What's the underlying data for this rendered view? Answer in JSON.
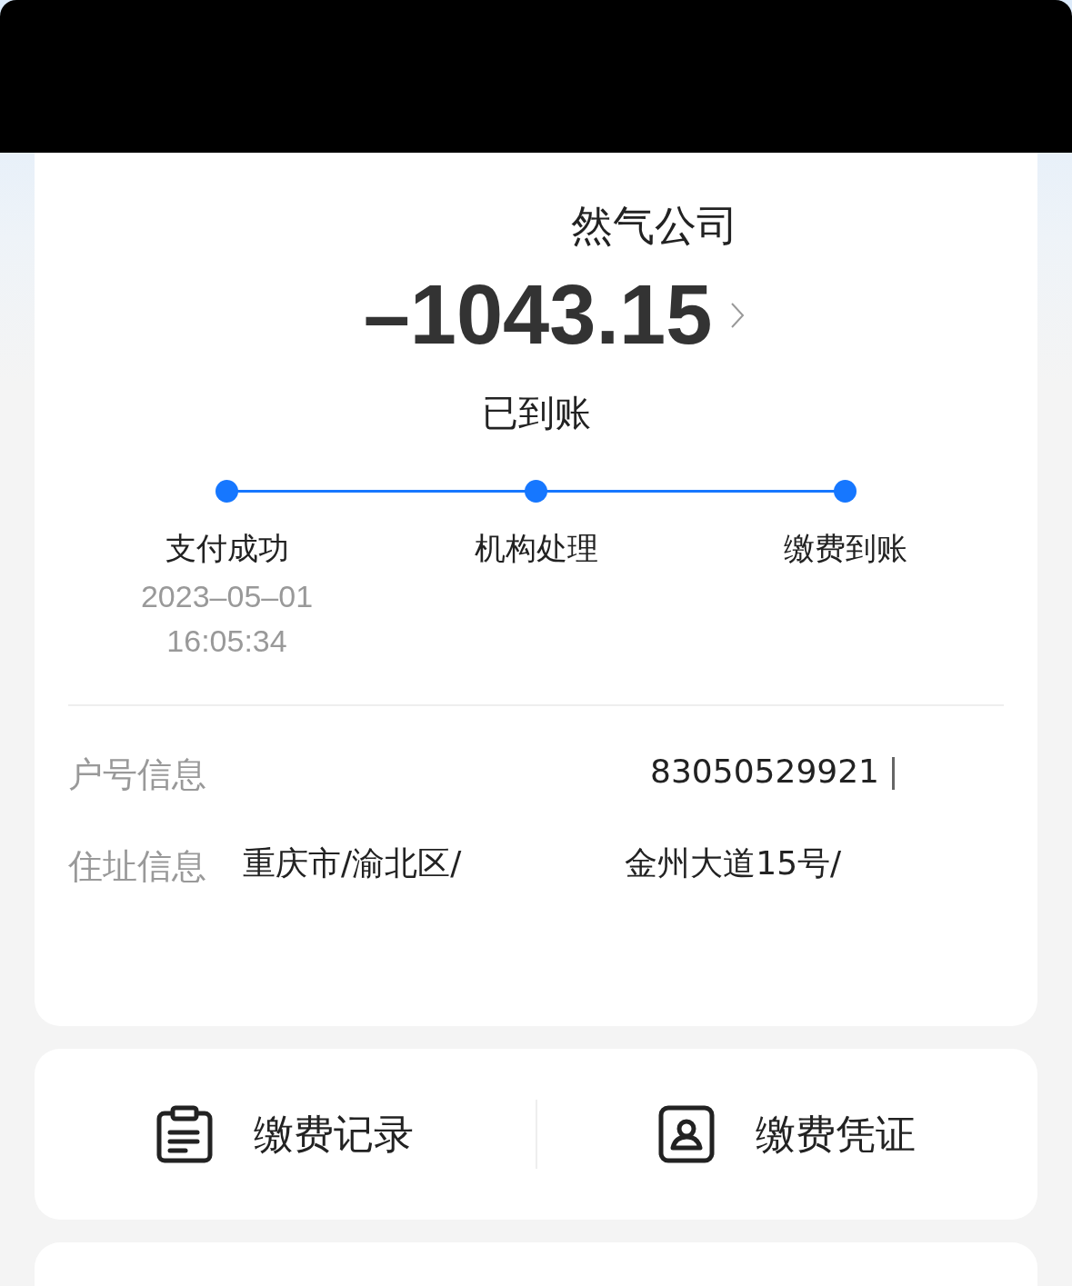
{
  "merchant": {
    "name": "然气公司"
  },
  "amount": "–1043.15",
  "status": "已到账",
  "steps": [
    {
      "label": "支付成功",
      "done": true,
      "date": "2023–05–01",
      "time": "16:05:34"
    },
    {
      "label": "机构处理",
      "done": true
    },
    {
      "label": "缴费到账",
      "done": true
    }
  ],
  "details": [
    {
      "label": "户号信息",
      "value": "83050529921",
      "kind": "account"
    },
    {
      "label": "住址信息",
      "value": "重庆市/渝北区/　　　　　金州大道15号/",
      "kind": "address"
    }
  ],
  "actions": [
    {
      "label": "缴费记录",
      "kind": "records"
    },
    {
      "label": "缴费凭证",
      "kind": "receipt"
    }
  ]
}
